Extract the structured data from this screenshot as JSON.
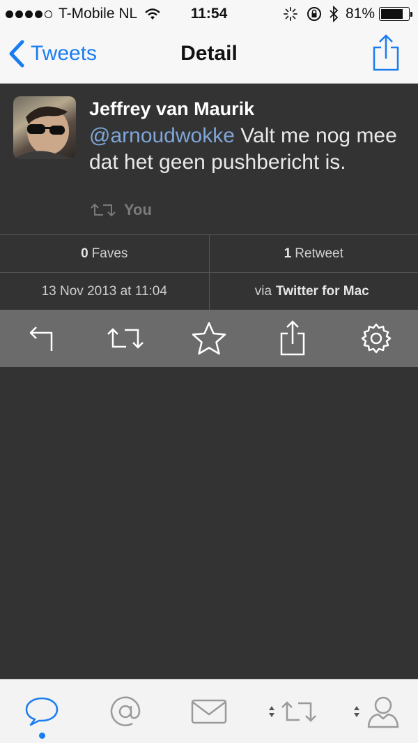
{
  "status_bar": {
    "carrier": "T-Mobile NL",
    "time": "11:54",
    "battery": "81%",
    "battery_level": 0.81,
    "signal_bars": 4
  },
  "nav": {
    "back_label": "Tweets",
    "title": "Detail",
    "icons": {
      "back": "chevron-left-icon",
      "share": "share-icon"
    }
  },
  "tweet": {
    "author": "Jeffrey van Maurik",
    "mention": "@arnoudwokke",
    "text": " Valt me nog mee dat het geen pushbericht is.",
    "retweeted_by": "You"
  },
  "stats": {
    "faves_count": "0",
    "faves_label": "Faves",
    "retweets_count": "1",
    "retweets_label": "Retweet",
    "date": "13 Nov 2013 at 11:04",
    "via_label": "via",
    "client": "Twitter for Mac"
  },
  "actions": [
    "reply-icon",
    "retweet-icon",
    "star-icon",
    "share-icon",
    "gear-icon"
  ],
  "tabs": [
    "timeline-icon",
    "mentions-icon",
    "messages-icon",
    "retweets-icon",
    "profile-icon"
  ],
  "colors": {
    "accent": "#1a7cf2",
    "background": "#333333",
    "action_bar": "#6b6b6b",
    "mention": "#7fa6d8"
  }
}
